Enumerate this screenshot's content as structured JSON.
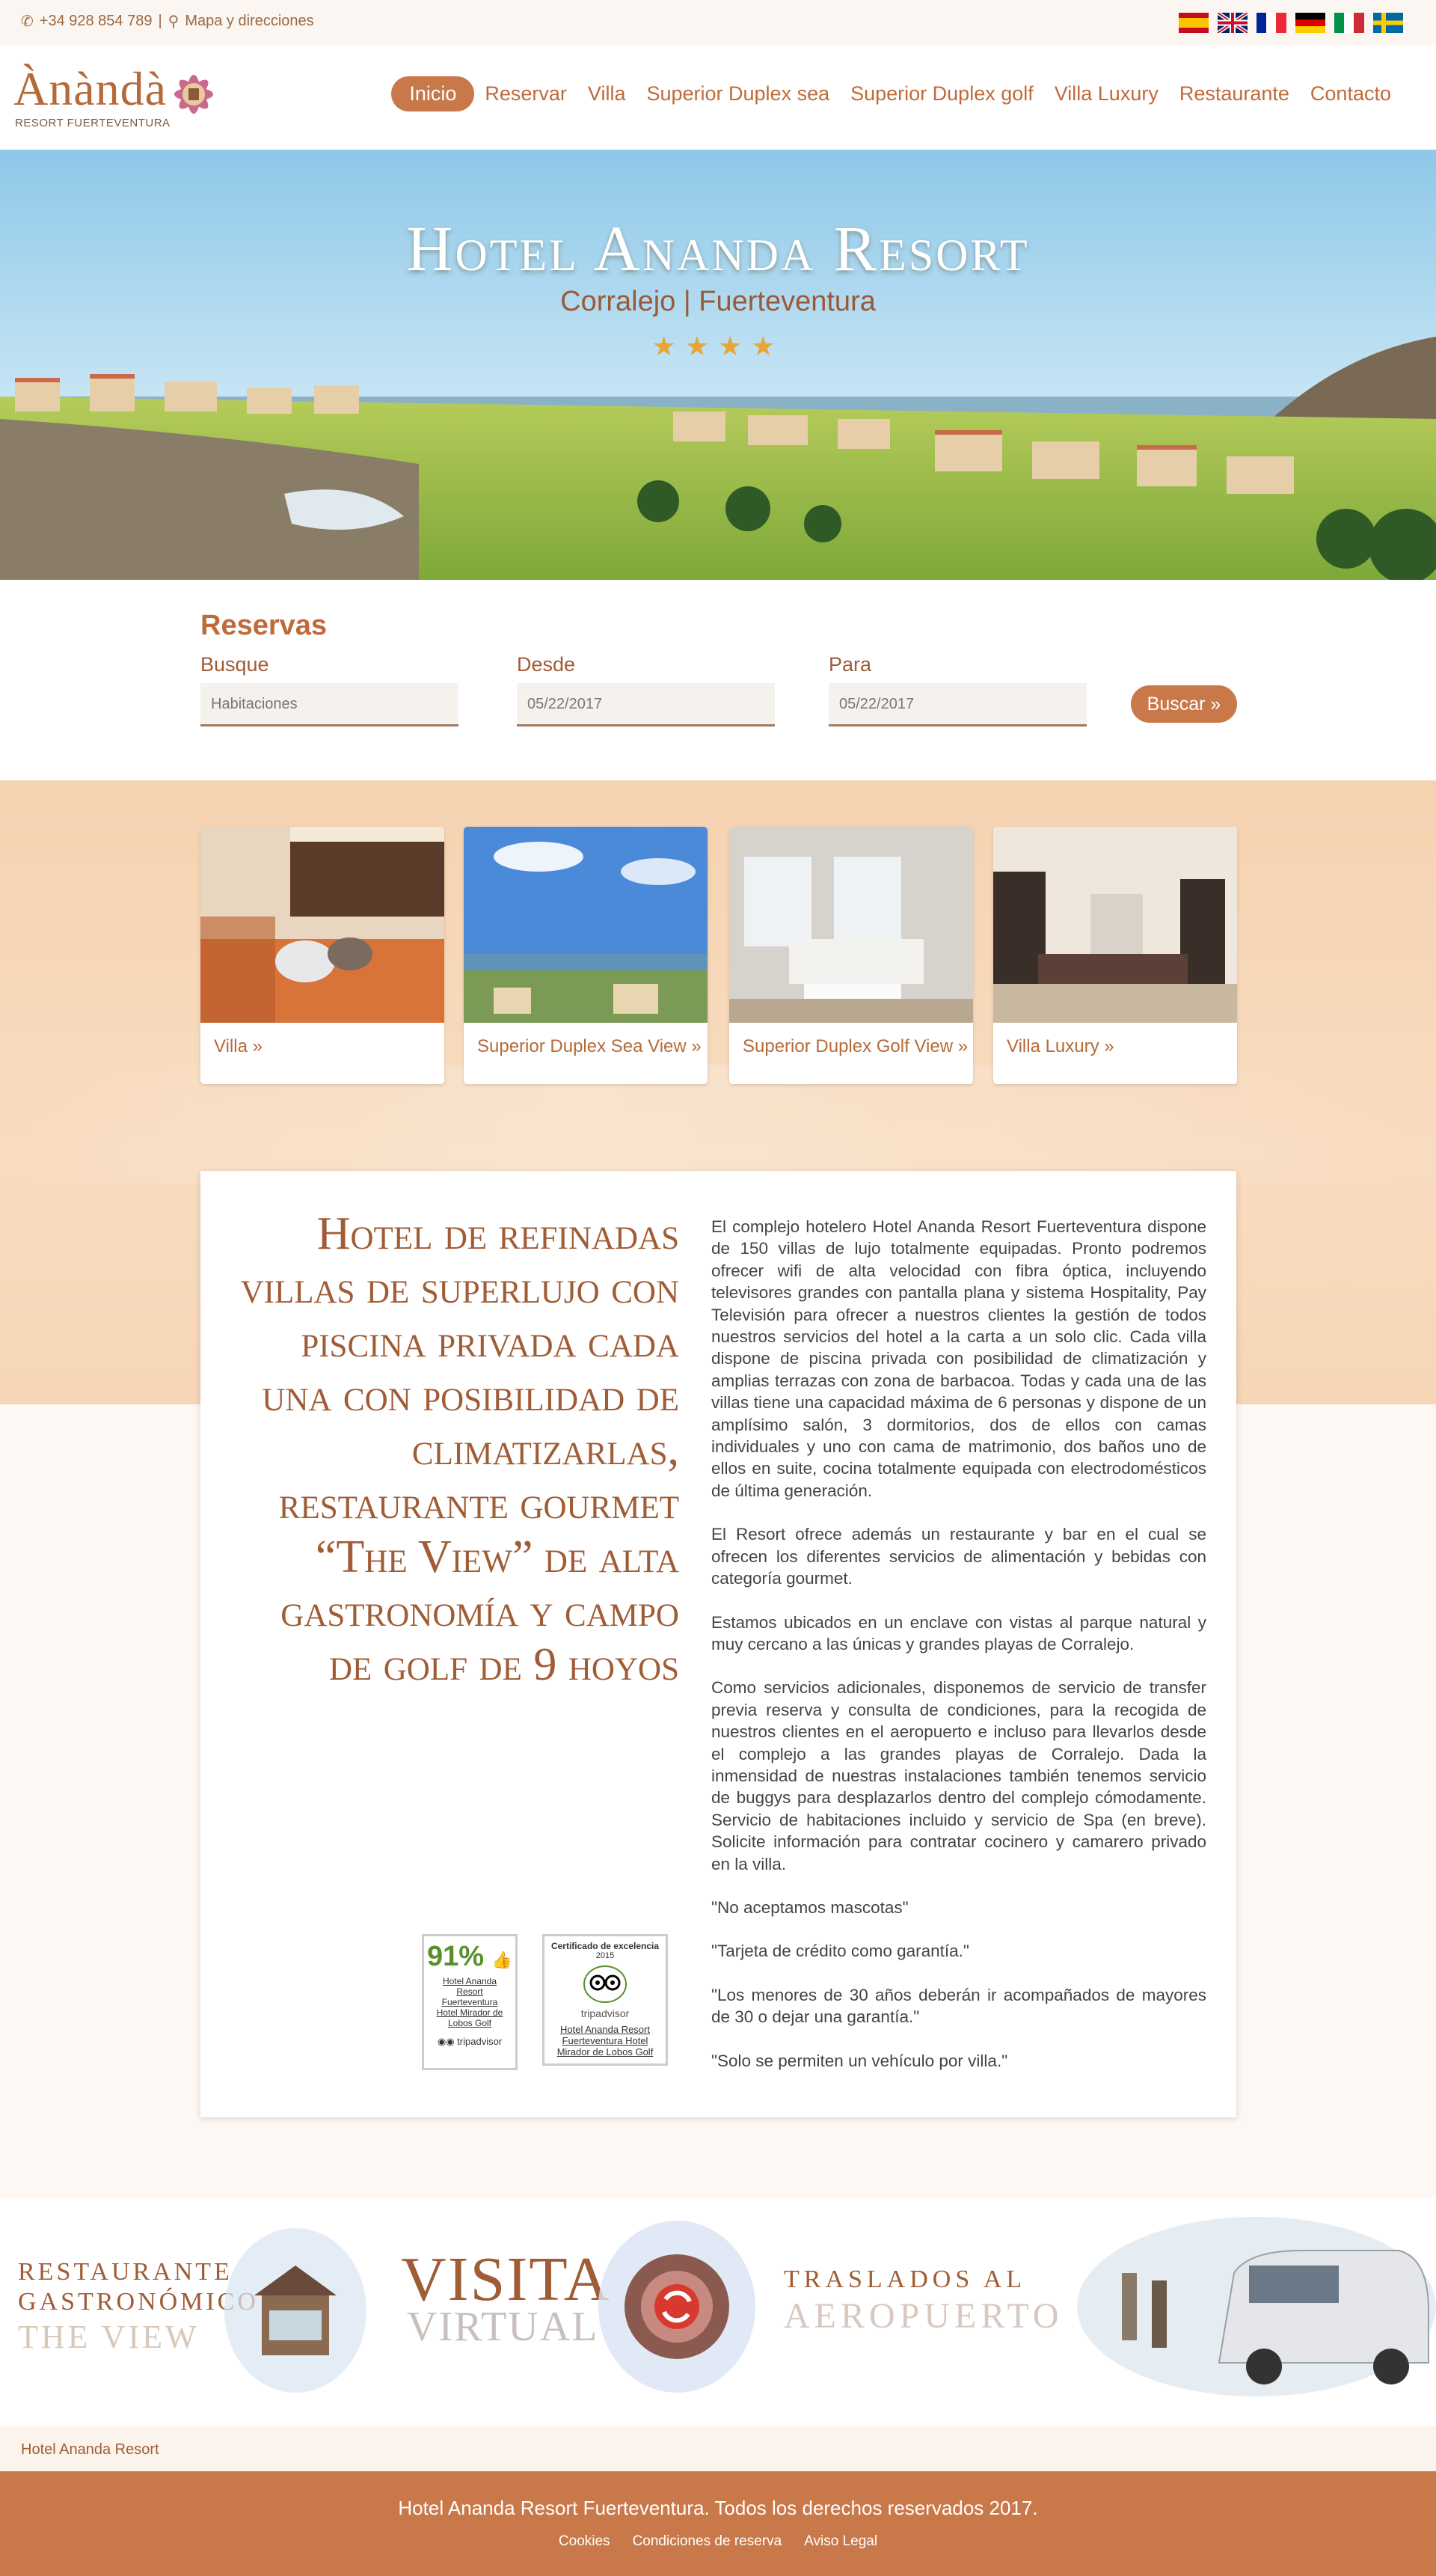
{
  "topbar": {
    "phone": "+34 928 854 789",
    "separator": "|",
    "map": "Mapa y direcciones",
    "flags": [
      "es-flag-icon",
      "uk-flag-icon",
      "fr-flag-icon",
      "de-flag-icon",
      "it-flag-icon",
      "se-flag-icon"
    ]
  },
  "logo": {
    "brand": "Ànàndà",
    "sub": "RESORT FUERTEVENTURA"
  },
  "nav": {
    "items": [
      "Inicio",
      "Reservar",
      "Villa",
      "Superior Duplex sea",
      "Superior Duplex golf",
      "Villa Luxury",
      "Restaurante",
      "Contacto"
    ],
    "active": "Inicio"
  },
  "hero": {
    "title": "Hotel Ananda Resort",
    "subtitle": "Corralejo | Fuerteventura",
    "stars": "★★★★"
  },
  "booking": {
    "title": "Reservas",
    "label_busque": "Busque",
    "label_desde": "Desde",
    "label_para": "Para",
    "rooms_placeholder": "Habitaciones",
    "from_value": "05/22/2017",
    "to_value": "05/22/2017",
    "search_button": "Buscar »"
  },
  "cards": [
    {
      "label": "Villa »"
    },
    {
      "label": "Superior Duplex Sea View »"
    },
    {
      "label": "Superior Duplex Golf View »"
    },
    {
      "label": "Villa Luxury »"
    }
  ],
  "content": {
    "headline": "Hotel de refinadas villas de superlujo con piscina privada cada una con posibilidad de climatizarlas, restaurante gourmet “The View” de alta gastronomía y campo de golf de 9 hoyos",
    "paragraphs": [
      "El complejo hotelero Hotel Ananda Resort Fuerteventura dispone de 150 villas de lujo totalmente equipadas. Pronto podremos ofrecer wifi de alta velocidad con fibra óptica, incluyendo televisores grandes con pantalla plana y sistema Hospitality, Pay Televisión para ofrecer a nuestros clientes la gestión de todos nuestros servicios del hotel a la carta a un solo clic. Cada villa dispone de piscina privada con posibilidad de climatización y amplias terrazas con zona de barbacoa. Todas y cada una de las villas tiene una capacidad máxima de 6 personas y dispone de un amplísimo salón, 3 dormitorios, dos de ellos con camas individuales y uno con cama de matrimonio, dos baños uno de ellos en suite, cocina totalmente equipada con electrodomésticos de última generación.",
      "El Resort ofrece además un restaurante y bar en el cual se ofrecen los diferentes servicios de alimentación y bebidas con categoría gourmet.",
      "Estamos ubicados en un enclave con vistas al parque natural y muy cercano a las únicas y grandes playas de Corralejo.",
      "Como servicios adicionales, disponemos de servicio de transfer previa reserva y consulta de condiciones, para la recogida de nuestros clientes en el aeropuerto e incluso para llevarlos desde el complejo a las grandes playas de Corralejo. Dada la inmensidad de nuestras instalaciones también tenemos servicio de buggys para desplazarlos dentro del complejo cómodamente. Servicio de habitaciones incluido y servicio de Spa (en breve). Solicite información para contratar cocinero y camarero privado en la villa.",
      "\"No aceptamos mascotas\"",
      "\"Tarjeta de crédito como garantía.\"",
      "\"Los menores de 30 años deberán ir acompañados de mayores de 30 o dejar una garantía.\"",
      "\"Solo se permiten un vehículo por villa.\""
    ],
    "badge1": {
      "pct": "91%",
      "text": "Hotel Ananda Resort Fuerteventura Hotel Mirador de Lobos Golf",
      "brand": "tripadvisor"
    },
    "badge2": {
      "t1": "Certificado de excelencia",
      "t2": "2015",
      "brand": "tripadvisor",
      "text": "Hotel Ananda Resort Fuerteventura Hotel Mirador de Lobos Golf"
    }
  },
  "promos": {
    "restaurant_l1": "RESTAURANTE",
    "restaurant_l2": "GASTRONÓMICO",
    "restaurant_l3": "THE VIEW",
    "visit_l1": "VISITA",
    "visit_l2": "VIRTUAL",
    "transfer_l1": "TRASLADOS AL",
    "transfer_l2": "AEROPUERTO"
  },
  "footer": {
    "name": "Hotel Ananda Resort",
    "copyright": "Hotel Ananda Resort Fuerteventura. Todos los derechos reservados 2017.",
    "links": [
      "Cookies",
      "Condiciones de reserva",
      "Aviso Legal"
    ]
  }
}
